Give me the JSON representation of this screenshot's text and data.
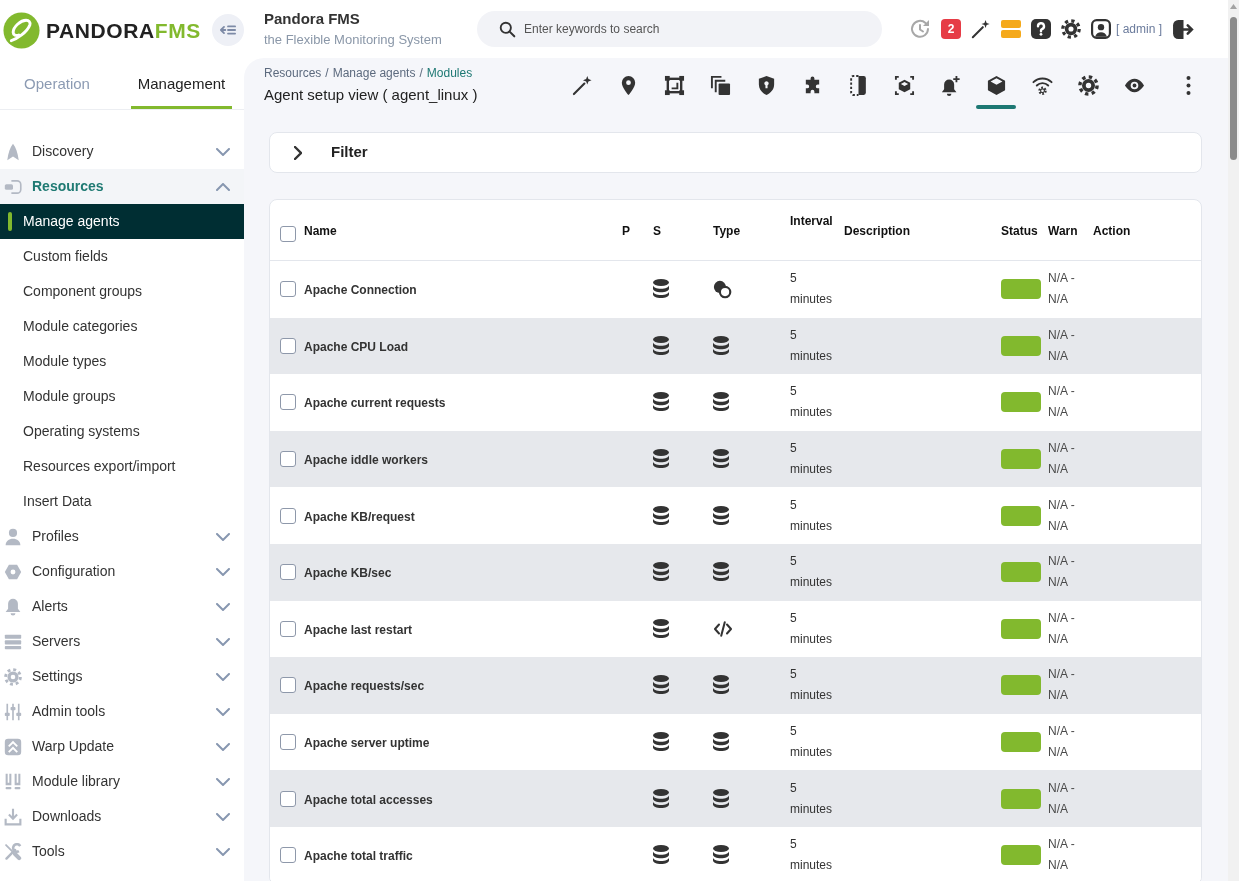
{
  "logo": {
    "text": "PANDORA",
    "accent": "FMS"
  },
  "sidebar": {
    "tabs": [
      {
        "label": "Operation",
        "selected": false
      },
      {
        "label": "Management",
        "selected": true
      }
    ],
    "menu": [
      {
        "label": "Discovery",
        "selected": false,
        "expanded": false
      },
      {
        "label": "Resources",
        "selected": true,
        "expanded": true,
        "children": [
          {
            "label": "Manage agents",
            "selected": true
          },
          {
            "label": "Custom fields",
            "selected": false
          },
          {
            "label": "Component groups",
            "selected": false
          },
          {
            "label": "Module categories",
            "selected": false
          },
          {
            "label": "Module types",
            "selected": false
          },
          {
            "label": "Module groups",
            "selected": false
          },
          {
            "label": "Operating systems",
            "selected": false
          },
          {
            "label": "Resources export/import",
            "selected": false
          },
          {
            "label": "Insert Data",
            "selected": false
          }
        ]
      },
      {
        "label": "Profiles",
        "selected": false,
        "expanded": false
      },
      {
        "label": "Configuration",
        "selected": false,
        "expanded": false
      },
      {
        "label": "Alerts",
        "selected": false,
        "expanded": false
      },
      {
        "label": "Servers",
        "selected": false,
        "expanded": false
      },
      {
        "label": "Settings",
        "selected": false,
        "expanded": false
      },
      {
        "label": "Admin tools",
        "selected": false,
        "expanded": false
      },
      {
        "label": "Warp Update",
        "selected": false,
        "expanded": false
      },
      {
        "label": "Module library",
        "selected": false,
        "expanded": false
      },
      {
        "label": "Downloads",
        "selected": false,
        "expanded": false
      },
      {
        "label": "Tools",
        "selected": false,
        "expanded": false
      }
    ]
  },
  "header": {
    "title": "Pandora FMS",
    "subtitle": "the Flexible Monitoring System",
    "search": {
      "placeholder": "Enter keywords to search"
    },
    "notifications": "2",
    "user": "[ admin ]"
  },
  "page": {
    "breadcrumb": {
      "separator": "/",
      "items": [
        {
          "label": "Resources",
          "selected": false
        },
        {
          "label": "Manage agents",
          "selected": false
        },
        {
          "label": "Modules",
          "selected": true
        }
      ]
    },
    "title": "Agent setup view ( agent_linux )",
    "agent_tabs": [
      {
        "selected": false
      },
      {
        "selected": false
      },
      {
        "selected": false
      },
      {
        "selected": false
      },
      {
        "selected": false
      },
      {
        "selected": false
      },
      {
        "selected": false
      },
      {
        "selected": false
      },
      {
        "selected": false
      },
      {
        "selected": true
      },
      {
        "selected": false
      },
      {
        "selected": false
      },
      {
        "selected": false
      }
    ]
  },
  "filter": {
    "label": "Filter",
    "expanded": false
  },
  "table": {
    "all_checked": false,
    "columns": [
      "Name",
      "P",
      "S",
      "Type",
      "Interval",
      "Description",
      "Status",
      "Warn",
      "Action"
    ],
    "rows": [
      {
        "name": "Apache Connection",
        "checked": false,
        "kind": "proc",
        "interval": "5 minutes",
        "color": "#82b92e",
        "warn": "N/A - N/A"
      },
      {
        "name": "Apache CPU Load",
        "checked": false,
        "kind": "data",
        "interval": "5 minutes",
        "color": "#82b92e",
        "warn": "N/A - N/A"
      },
      {
        "name": "Apache current requests",
        "checked": false,
        "kind": "data",
        "interval": "5 minutes",
        "color": "#82b92e",
        "warn": "N/A - N/A"
      },
      {
        "name": "Apache iddle workers",
        "checked": false,
        "kind": "data",
        "interval": "5 minutes",
        "color": "#82b92e",
        "warn": "N/A - N/A"
      },
      {
        "name": "Apache KB/request",
        "checked": false,
        "kind": "data",
        "interval": "5 minutes",
        "color": "#82b92e",
        "warn": "N/A - N/A"
      },
      {
        "name": "Apache KB/sec",
        "checked": false,
        "kind": "data",
        "interval": "5 minutes",
        "color": "#82b92e",
        "warn": "N/A - N/A"
      },
      {
        "name": "Apache last restart",
        "checked": false,
        "kind": "string",
        "interval": "5 minutes",
        "color": "#82b92e",
        "warn": "N/A - N/A"
      },
      {
        "name": "Apache requests/sec",
        "checked": false,
        "kind": "data",
        "interval": "5 minutes",
        "color": "#82b92e",
        "warn": "N/A - N/A"
      },
      {
        "name": "Apache server uptime",
        "checked": false,
        "kind": "data",
        "interval": "5 minutes",
        "color": "#82b92e",
        "warn": "N/A - N/A"
      },
      {
        "name": "Apache total accesses",
        "checked": false,
        "kind": "data",
        "interval": "5 minutes",
        "color": "#82b92e",
        "warn": "N/A - N/A"
      },
      {
        "name": "Apache total traffic",
        "checked": false,
        "kind": "data",
        "interval": "5 minutes",
        "color": "#82b92e",
        "warn": "N/A - N/A"
      }
    ]
  }
}
